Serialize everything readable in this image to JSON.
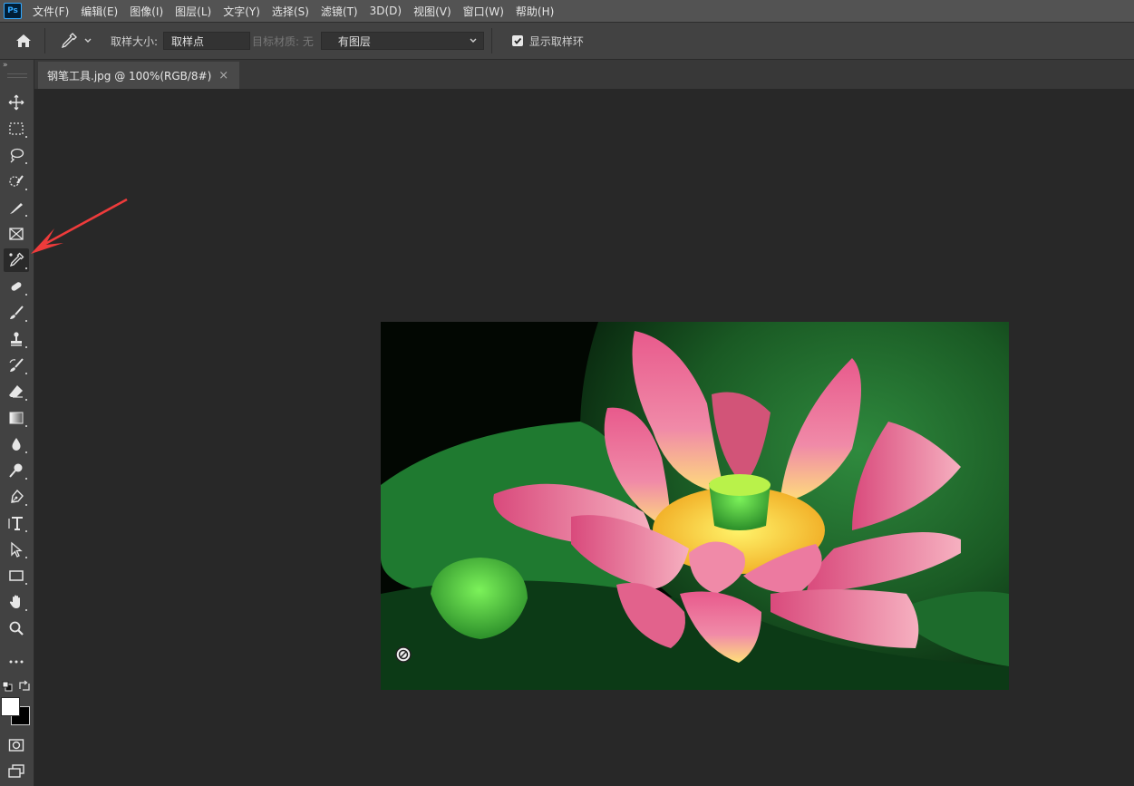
{
  "app": {
    "logo_text": "Ps"
  },
  "menu": {
    "items": [
      "文件(F)",
      "编辑(E)",
      "图像(I)",
      "图层(L)",
      "文字(Y)",
      "选择(S)",
      "滤镜(T)",
      "3D(D)",
      "视图(V)",
      "窗口(W)",
      "帮助(H)"
    ]
  },
  "options": {
    "sample_size_label": "取样大小:",
    "sample_size_value": "取样点",
    "sample_target_label": "目标材质: 无",
    "sample_layers_value": "有图层",
    "show_ring_label": "显示取样环",
    "show_ring_checked": true
  },
  "document": {
    "tab_title": "钢笔工具.jpg @ 100%(RGB/8#)",
    "close_glyph": "×"
  },
  "toolbar": {
    "collapse_glyph": "»",
    "tools": [
      "move-tool",
      "marquee-tool",
      "lasso-tool",
      "quick-select-tool",
      "pen-tool",
      "frame-tool",
      "eyedropper-tool",
      "healing-tool",
      "brush-tool",
      "clone-stamp-tool",
      "history-brush-tool",
      "eraser-tool",
      "gradient-tool",
      "blur-tool",
      "dodge-tool",
      "pen-path-tool",
      "type-tool",
      "path-select-tool",
      "rectangle-tool",
      "hand-tool",
      "zoom-tool",
      "more-tools"
    ],
    "active_tool": "eyedropper-tool",
    "foreground_color": "#ffffff",
    "background_color": "#000000"
  },
  "colors": {
    "menubar": "#535353",
    "panel": "#424242",
    "canvas_bg": "#282828",
    "annotation_arrow": "#ee3b3b"
  }
}
